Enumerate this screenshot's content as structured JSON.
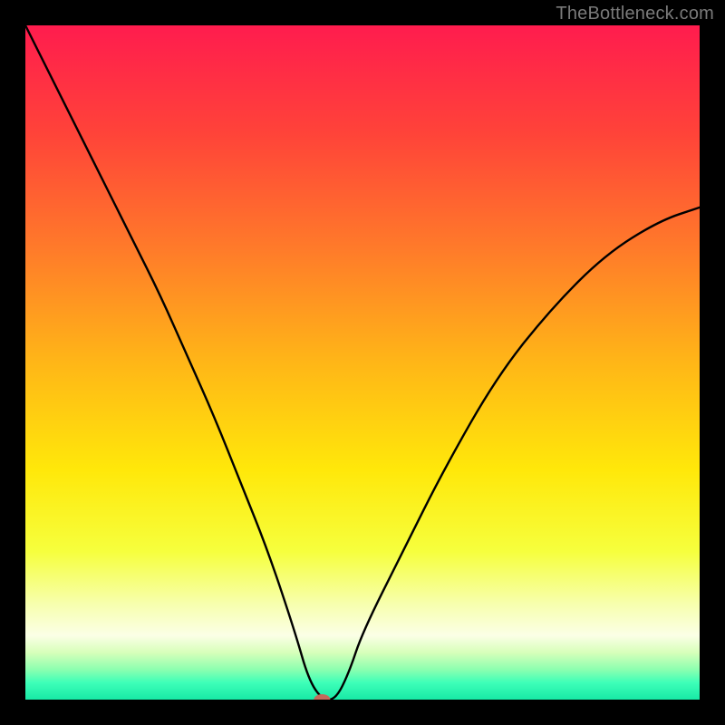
{
  "watermark": "TheBottleneck.com",
  "chart_data": {
    "type": "line",
    "title": "",
    "xlabel": "",
    "ylabel": "",
    "xlim": [
      0,
      100
    ],
    "ylim": [
      0,
      100
    ],
    "grid": false,
    "series": [
      {
        "name": "curve",
        "x": [
          0,
          4,
          8,
          12,
          16,
          20,
          24,
          28,
          32,
          36,
          40,
          42,
          44,
          46,
          48,
          50,
          56,
          62,
          70,
          78,
          86,
          94,
          100
        ],
        "y": [
          100,
          92,
          84,
          76,
          68,
          60,
          51,
          42,
          32,
          22,
          10,
          3,
          0,
          0,
          4,
          10,
          22,
          34,
          48,
          58,
          66,
          71,
          73
        ]
      }
    ],
    "marker": {
      "x": 44,
      "y": 0,
      "color": "#c46a5b",
      "rx": 9,
      "ry": 6
    },
    "gradient_stops": [
      {
        "offset": 0.0,
        "color": "#ff1c4e"
      },
      {
        "offset": 0.16,
        "color": "#ff4339"
      },
      {
        "offset": 0.33,
        "color": "#ff7a2a"
      },
      {
        "offset": 0.5,
        "color": "#ffb617"
      },
      {
        "offset": 0.66,
        "color": "#ffe80a"
      },
      {
        "offset": 0.78,
        "color": "#f6ff3d"
      },
      {
        "offset": 0.86,
        "color": "#f7ffb0"
      },
      {
        "offset": 0.905,
        "color": "#fbffe6"
      },
      {
        "offset": 0.93,
        "color": "#d7ffba"
      },
      {
        "offset": 0.955,
        "color": "#8dffb0"
      },
      {
        "offset": 0.975,
        "color": "#3dffb8"
      },
      {
        "offset": 1.0,
        "color": "#18e9a6"
      }
    ]
  }
}
